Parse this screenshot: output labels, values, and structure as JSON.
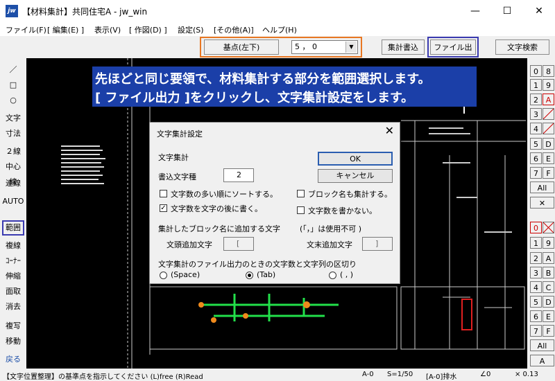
{
  "window": {
    "title": "【材料集計】共同住宅A - jw_win",
    "icon_label": "jw",
    "min": "—",
    "max": "☐",
    "close": "✕"
  },
  "menu": [
    "ファイル(F)",
    "[ 編集(E) ]",
    "表示(V)",
    "[ 作図(D) ]",
    "設定(S)",
    "[その他(A)]",
    "ヘルプ(H)"
  ],
  "toolbar": {
    "base_point": "基点(左下)",
    "scale_value": "5 ， 0",
    "aggregate_write": "集計書込",
    "file_output": "ファイル出力",
    "text_search": "文字検索"
  },
  "left_tools": [
    "／",
    "□",
    "○",
    "文字",
    "寸法",
    "２線",
    "中心線",
    "連線",
    "AUTO",
    "範囲",
    "複線",
    "ｺｰﾅｰ",
    "伸縮",
    "面取",
    "消去",
    "複写",
    "移動",
    "戻る"
  ],
  "right_layers": {
    "top_left": [
      "0",
      "1",
      "2",
      "3",
      "4",
      "5",
      "6",
      "7"
    ],
    "top_right": [
      "8",
      "9",
      "A",
      "",
      "",
      "D",
      "E",
      "F"
    ],
    "all": "All",
    "bot_left": [
      "0",
      "1",
      "2",
      "3",
      "4",
      "5",
      "6",
      "7"
    ],
    "bot_right": [
      "",
      "9",
      "A",
      "B",
      "C",
      "D",
      "E",
      "F"
    ],
    "all2": "All",
    "a_label": "A"
  },
  "annotation": {
    "line1": "先ほどと同じ要領で、材料集計する部分を範囲選択します。",
    "line2": "[ ファイル出力 ]をクリックし、文字集計設定をします。"
  },
  "dialog": {
    "title": "文字集計設定",
    "close": "✕",
    "section": "文字集計",
    "ok": "OK",
    "cancel": "キャンセル",
    "write_type_label": "書込文字種",
    "write_type_value": "2",
    "opt_sort": "文字数の多い順にソートする。",
    "opt_sort_checked": false,
    "opt_block": "ブロック名も集計する。",
    "opt_block_checked": false,
    "opt_after": "文字数を文字の後に書く。",
    "opt_after_checked": true,
    "opt_nowrite": "文字数を書かない。",
    "opt_nowrite_checked": false,
    "block_add_label": "集計したブロック名に追加する文字",
    "unusable_note": "(「，」は使用不可 )",
    "prefix_label": "文頭追加文字",
    "prefix_value": "[",
    "suffix_label": "文末追加文字",
    "suffix_value": "]",
    "separator_label": "文字集計のファイル出力のときの文字数と文字列の区切り",
    "sep_space": "(Space)",
    "sep_tab": "(Tab)",
    "sep_comma": "( , )",
    "sep_selected": "tab"
  },
  "status": {
    "message": "【文字位置整理】の基準点を指示してください (L)free (R)Read",
    "paper": "A-0",
    "scale": "S=1/50",
    "layer": "[A-0]排水",
    "angle": "∠0",
    "zoom": "× 0.13"
  },
  "colors": {
    "annotation_bg": "#1b3fa8",
    "highlight_orange": "#e87722",
    "highlight_blue": "#3a3ab0",
    "pipe_green": "#22e04a",
    "node_orange": "#f08a1c"
  }
}
